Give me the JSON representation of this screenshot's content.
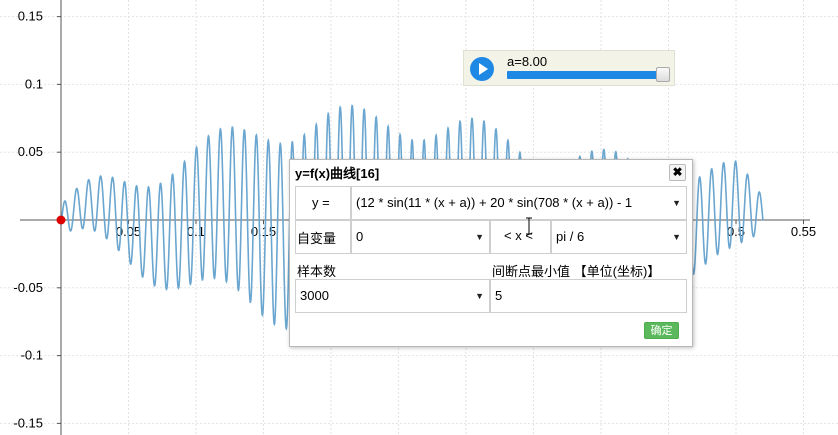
{
  "chart_data": {
    "type": "line",
    "title": "",
    "xlabel": "",
    "ylabel": "",
    "x_ticks": [
      "0.05",
      "0.1",
      "0.15",
      "0.5",
      "0.55"
    ],
    "y_ticks": [
      "0.15",
      "0.1",
      "0.05",
      "-0.05",
      "-0.1",
      "-0.15"
    ],
    "xlim": [
      -0.02,
      0.56
    ],
    "ylim": [
      -0.155,
      0.155
    ],
    "grid": true,
    "series": [
      {
        "type": "curve",
        "description_points_sampled": false,
        "x": [
          0.0,
          0.05,
          0.1,
          0.15,
          0.2,
          0.25,
          0.3,
          0.35,
          0.4,
          0.45,
          0.5,
          0.52
        ],
        "envelope": [
          0.012,
          0.032,
          0.055,
          0.073,
          0.081,
          0.08,
          0.072,
          0.058,
          0.045,
          0.04,
          0.035,
          0.015
        ],
        "color": "#6aa6cf"
      }
    ],
    "point": {
      "x": 0.0,
      "y": 0.0,
      "color": "#dd0000"
    }
  },
  "slider": {
    "label": "a=8.00",
    "value_fraction": 0.98
  },
  "dialog": {
    "title": "y=f(x)曲线[16]",
    "close": "✖",
    "y_label": "y =",
    "expression": "(12 * sin(11 * (x + a)) + 20 * sin(708 * (x + a)) - 1",
    "var_label": "自变量",
    "x_min": "0",
    "between_label": "< x <",
    "x_max": "pi / 6",
    "samples_label": "样本数",
    "samples": "3000",
    "break_label": "间断点最小值 【单位(坐标)】",
    "break_value": "5",
    "confirm": "确定"
  },
  "colors": {
    "curve": "#6aa6cf",
    "slider": "#1e88e5",
    "confirm": "#5cb85c",
    "point": "#dd0000"
  }
}
